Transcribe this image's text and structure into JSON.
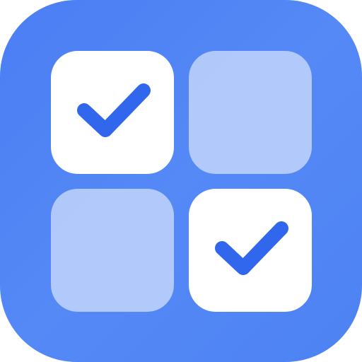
{
  "icon": {
    "name": "checklist-grid-app-icon",
    "accent_color": "#4f85f5",
    "check_color": "#3167ec",
    "tiles": [
      {
        "position": "top-left",
        "state": "checked",
        "icon": "check-icon"
      },
      {
        "position": "top-right",
        "state": "unchecked"
      },
      {
        "position": "bottom-left",
        "state": "unchecked"
      },
      {
        "position": "bottom-right",
        "state": "checked",
        "icon": "check-icon"
      }
    ]
  }
}
